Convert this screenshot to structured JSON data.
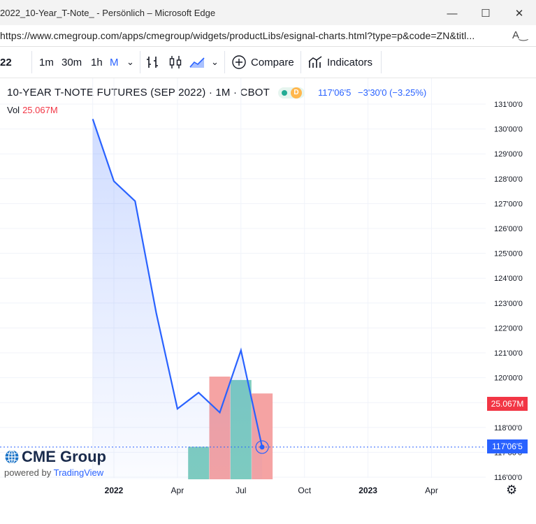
{
  "window": {
    "title": "2022_10-Year_T-Note_ - Persönlich – Microsoft Edge",
    "url": "https://www.cmegroup.com/apps/cmegroup/widgets/productLibs/esignal-charts.html?type=p&code=ZN&titl..."
  },
  "toolbar": {
    "symbol": "22",
    "intervals": [
      "1m",
      "30m",
      "1h",
      "M"
    ],
    "active_interval": "M",
    "compare_label": "Compare",
    "indicators_label": "Indicators"
  },
  "legend": {
    "title": "10-YEAR T-NOTE FUTURES (SEP 2022) · 1M · CBOT",
    "market_status": "D",
    "last": "117'06'5",
    "change": "−3'30'0 (−3.25%)",
    "vol_label": "Vol",
    "vol_value": "25.067M"
  },
  "price_axis": {
    "ticks": [
      "131'00'0",
      "130'00'0",
      "129'00'0",
      "128'00'0",
      "127'00'0",
      "126'00'0",
      "125'00'0",
      "124'00'0",
      "123'00'0",
      "122'00'0",
      "121'00'0",
      "120'00'0",
      "118'00'0",
      "117'00'0",
      "116'00'0"
    ],
    "last_price_tag": "117'06'5",
    "volume_tag": "25.067M"
  },
  "time_axis": {
    "labels": [
      "2022",
      "Apr",
      "Jul",
      "Oct",
      "2023",
      "Apr"
    ]
  },
  "watermark": {
    "brand": "CME Group",
    "powered_by": "powered by",
    "provider": "TradingView"
  },
  "colors": {
    "line": "#2962ff",
    "volume_up": "#7fcdbf",
    "volume_down": "#f5a3a3",
    "tag_red": "#f23645",
    "tag_blue": "#2962ff"
  },
  "chart_data": {
    "type": "line",
    "title": "10-YEAR T-NOTE FUTURES (SEP 2022) · 1M · CBOT",
    "x": [
      "2021-12",
      "2022-01",
      "2022-02",
      "2022-03",
      "2022-04",
      "2022-05",
      "2022-06",
      "2022-07",
      "2022-08"
    ],
    "y": [
      130.4,
      127.9,
      127.1,
      122.6,
      118.75,
      119.4,
      118.6,
      121.1,
      117.21
    ],
    "ylim": [
      115.9,
      131.3
    ],
    "volume": {
      "x": [
        "2022-05",
        "2022-06",
        "2022-07",
        "2022-08"
      ],
      "direction": [
        "up",
        "down",
        "up",
        "down"
      ],
      "values": [
        9.5,
        30,
        29,
        25.067
      ],
      "unit": "M"
    },
    "grid": true
  }
}
